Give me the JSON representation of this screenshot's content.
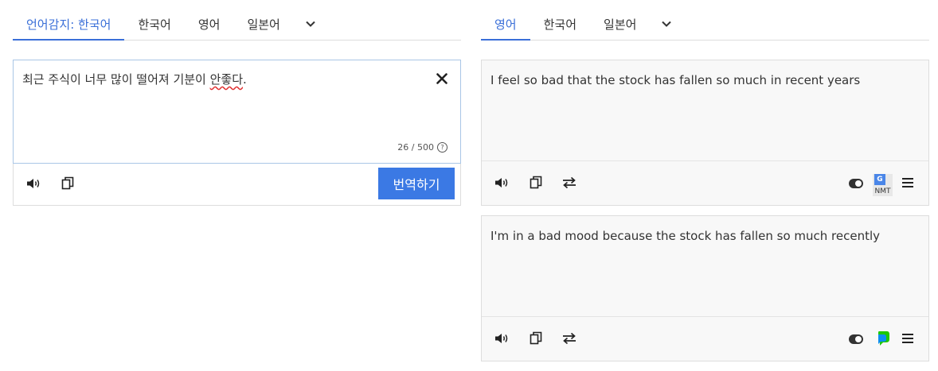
{
  "source_tabs": [
    {
      "label": "언어감지: 한국어",
      "active": true
    },
    {
      "label": "한국어",
      "active": false
    },
    {
      "label": "영어",
      "active": false
    },
    {
      "label": "일본어",
      "active": false
    }
  ],
  "target_tabs": [
    {
      "label": "영어",
      "active": true
    },
    {
      "label": "한국어",
      "active": false
    },
    {
      "label": "일본어",
      "active": false
    }
  ],
  "source": {
    "text_main": "최근 주식이 너무 많이 떨어져 기분이 ",
    "text_marked": "안좋다",
    "text_end": ".",
    "char_count": "26 / 500",
    "help_glyph": "?"
  },
  "translate_button": "번역하기",
  "results": [
    {
      "text": "I feel so bad that the stock has fallen so much in recent years",
      "engine_badge": "G",
      "engine_label": "NMT"
    },
    {
      "text": "I'm in a bad mood because the stock has fallen so much recently"
    }
  ],
  "colors": {
    "accent": "#3a6fd8",
    "button": "#3b79e4",
    "result_bg": "#f8f8f8"
  }
}
